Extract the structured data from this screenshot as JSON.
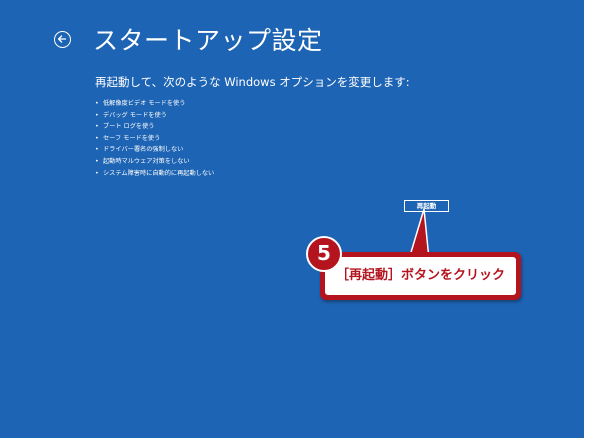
{
  "header": {
    "back_icon": "back-arrow-icon",
    "title": "スタートアップ設定"
  },
  "main": {
    "description": "再起動して、次のような Windows オプションを変更します:",
    "options": [
      "低解像度ビデオ モードを使う",
      "デバッグ モードを使う",
      "ブート ログを使う",
      "セーフ モードを使う",
      "ドライバー署名の強制しない",
      "起動時マルウェア対策をしない",
      "システム障害時に自動的に再起動しない"
    ],
    "restart_label": "再起動"
  },
  "annotation": {
    "step_number": "5",
    "callout_text": "［再起動］ボタンをクリック",
    "accent_color": "#b4141e"
  },
  "colors": {
    "background": "#1e64b4",
    "text": "#ffffff"
  }
}
